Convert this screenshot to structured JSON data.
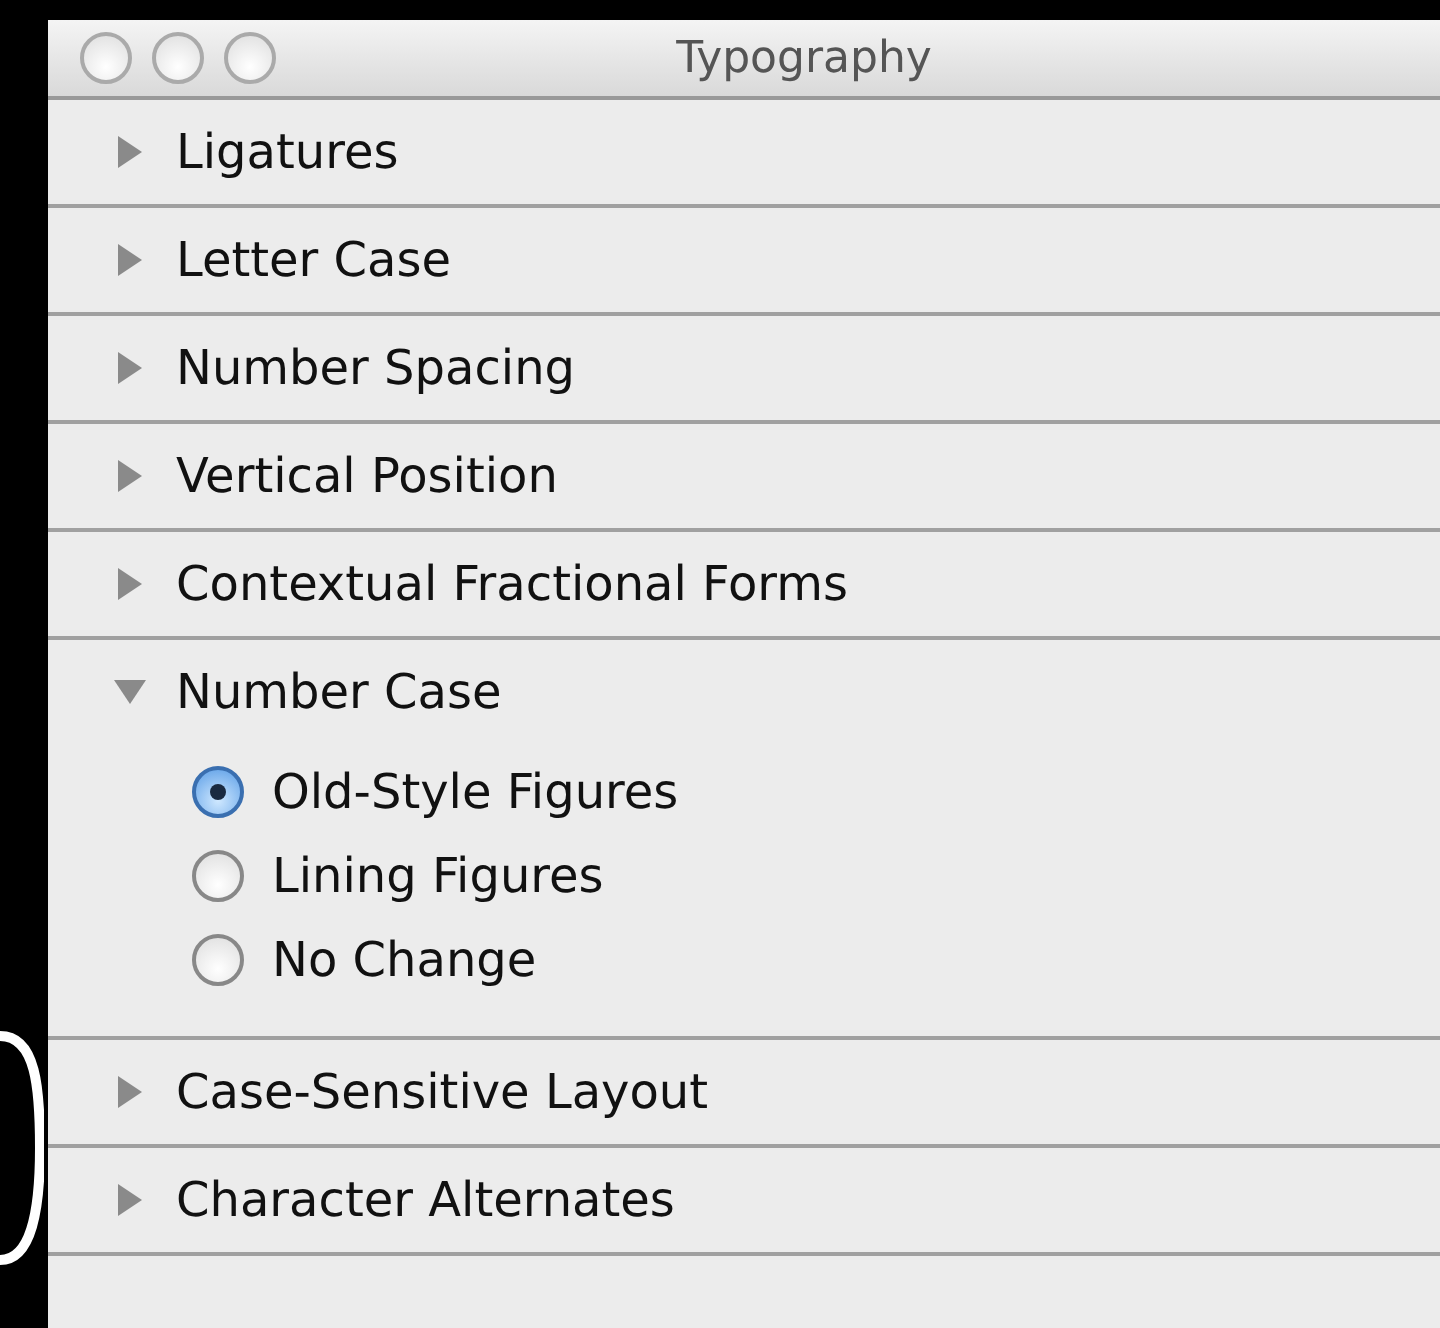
{
  "window": {
    "title": "Typography"
  },
  "sections": [
    {
      "label": "Ligatures",
      "expanded": false
    },
    {
      "label": "Letter Case",
      "expanded": false
    },
    {
      "label": "Number Spacing",
      "expanded": false
    },
    {
      "label": "Vertical Position",
      "expanded": false
    },
    {
      "label": "Contextual Fractional Forms",
      "expanded": false
    },
    {
      "label": "Number Case",
      "expanded": true,
      "options": [
        {
          "label": "Old-Style Figures",
          "selected": true
        },
        {
          "label": "Lining Figures",
          "selected": false
        },
        {
          "label": "No Change",
          "selected": false
        }
      ]
    },
    {
      "label": "Case-Sensitive Layout",
      "expanded": false
    },
    {
      "label": "Character Alternates",
      "expanded": false
    }
  ]
}
